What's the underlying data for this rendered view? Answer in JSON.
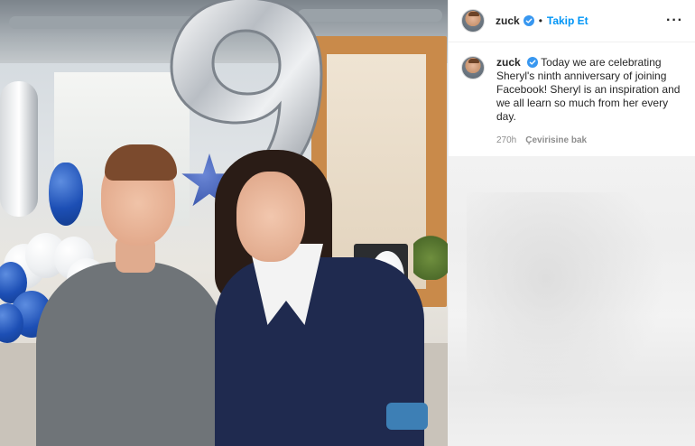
{
  "post_header": {
    "username": "zuck",
    "separator": "•",
    "follow_label": "Takip Et",
    "more_label": "···"
  },
  "caption": {
    "username": "zuck",
    "text": "Today we are celebrating Sheryl's ninth anniversary of joining Facebook! Sheryl is an inspiration and we all learn so much from her every day."
  },
  "meta": {
    "time": "270h",
    "translate_label": "Çevirisine bak"
  },
  "colors": {
    "link_blue": "#0095f6",
    "verified_blue": "#3897f0",
    "muted_text": "#8e8e8e"
  },
  "icons": {
    "verified": "verified-badge-icon",
    "more": "more-options-icon"
  }
}
